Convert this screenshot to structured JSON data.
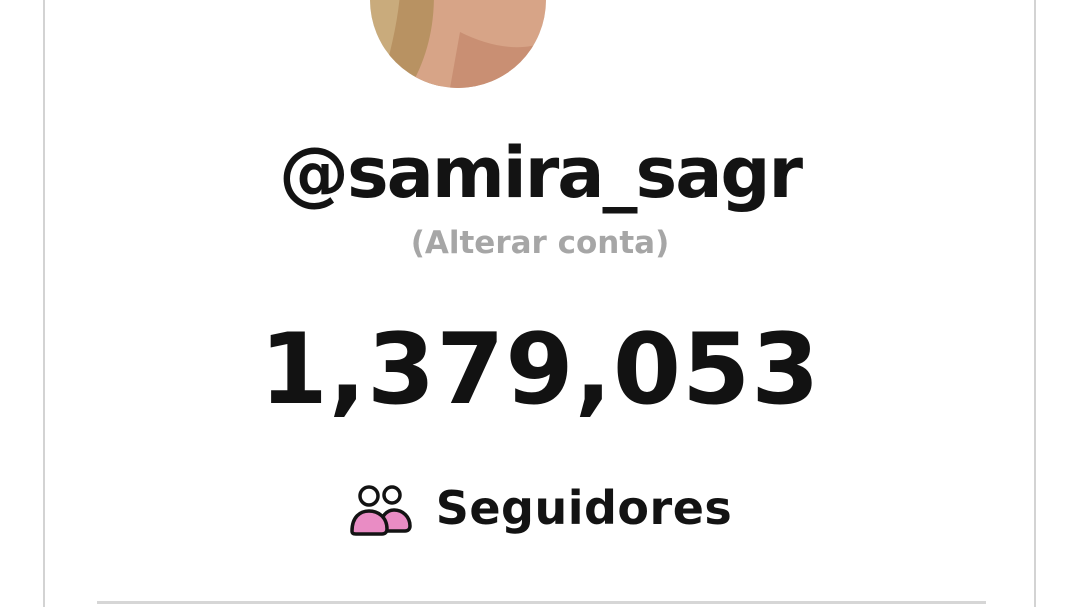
{
  "profile": {
    "username": "@samira_sagr",
    "switch_account_label": "(Alterar conta)",
    "avatar_icon": "profile-photo",
    "follower_count": "1,379,053",
    "followers_label": "Seguidores",
    "followers_icon": "people-icon"
  },
  "colors": {
    "text_primary": "#131313",
    "text_muted": "#a6a6a6",
    "icon_accent": "#e98cc4",
    "border": "#d3d3d3"
  }
}
